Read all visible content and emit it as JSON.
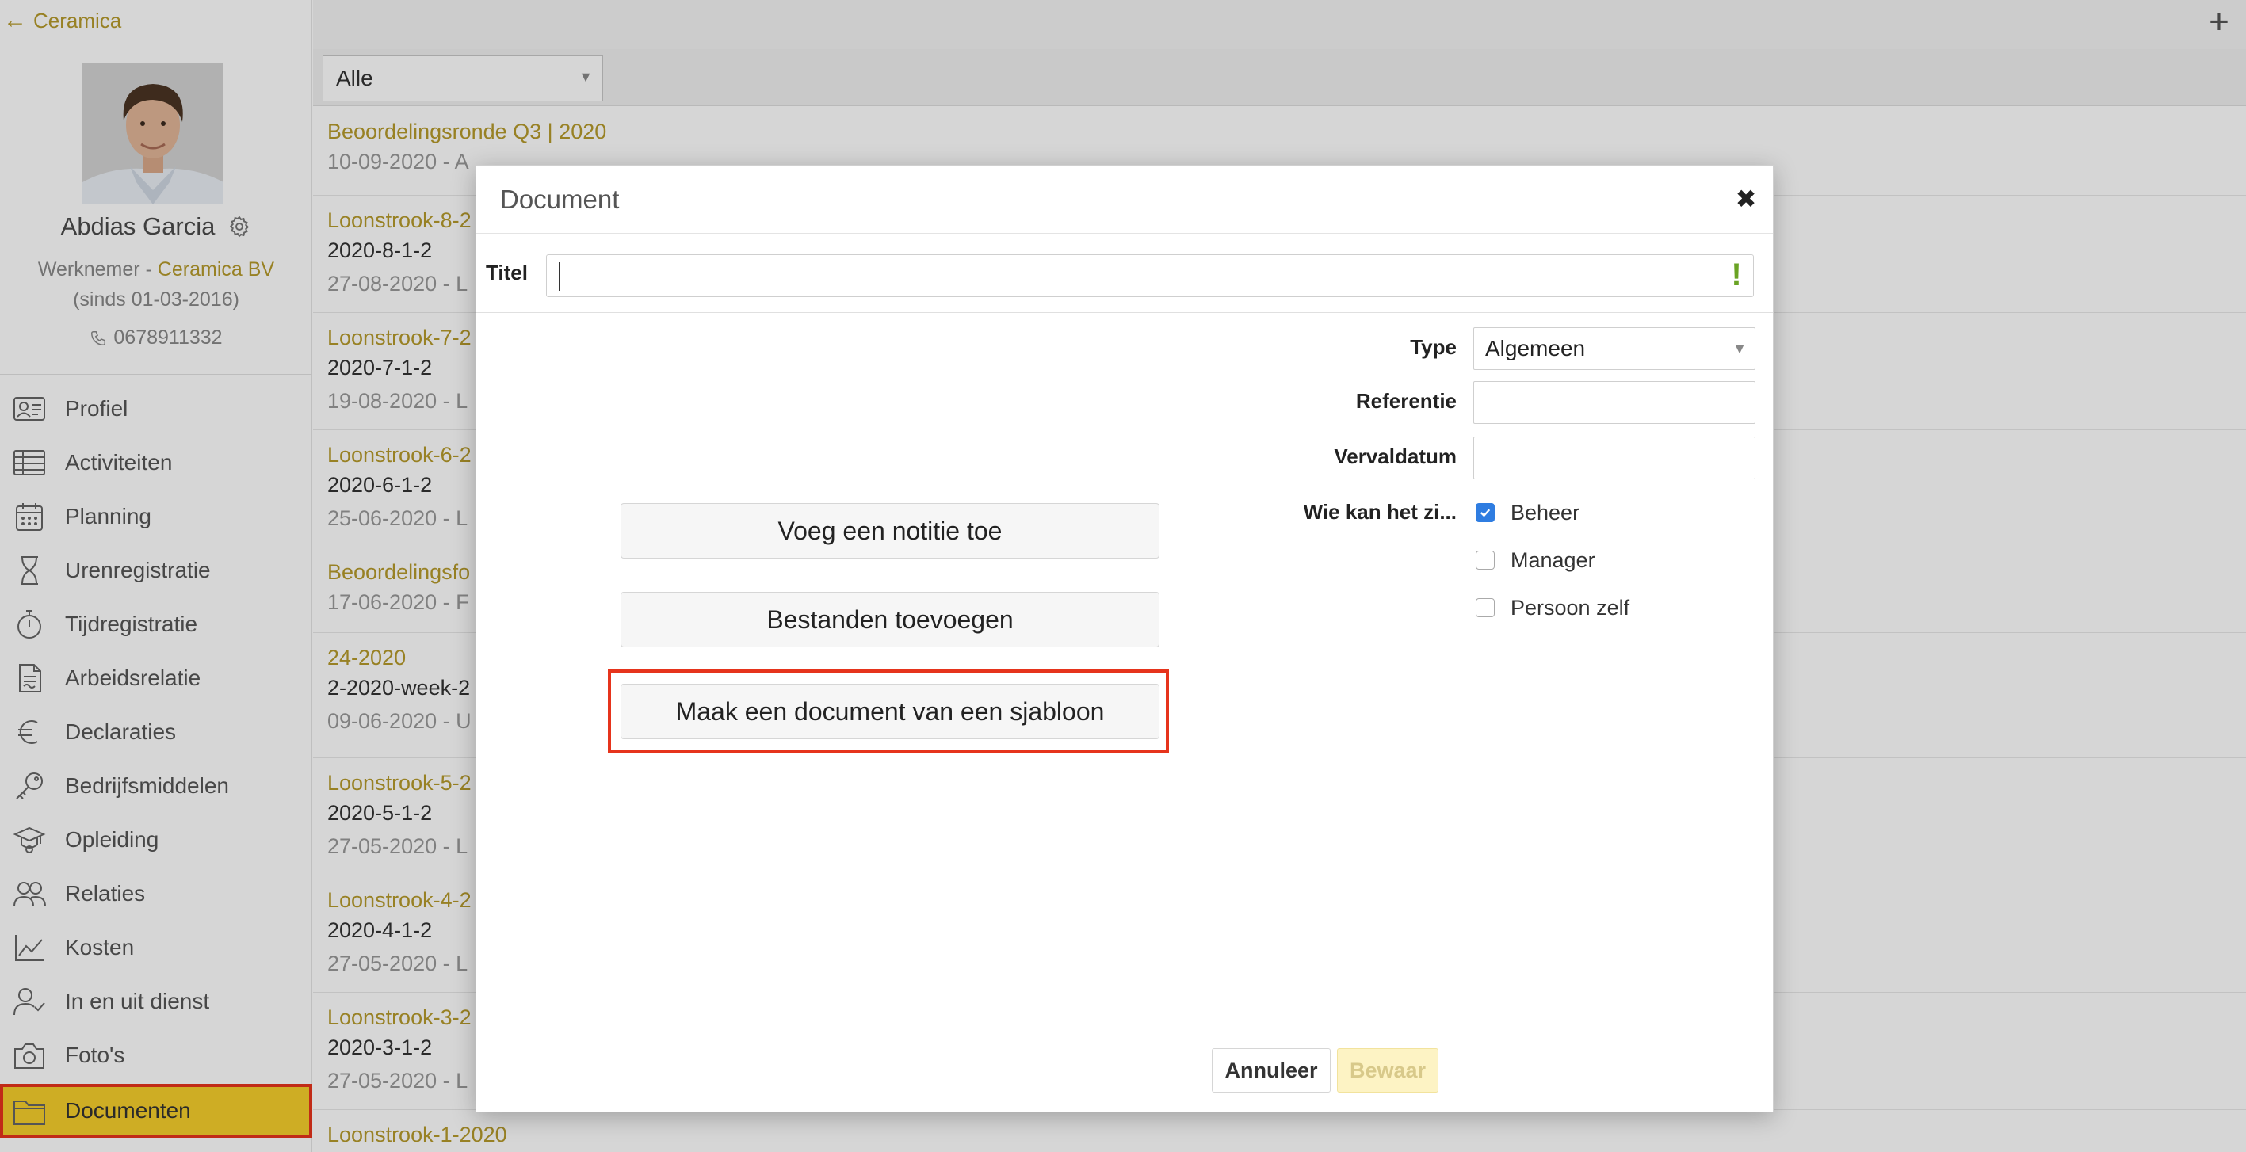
{
  "back_link": {
    "label": "Ceramica"
  },
  "person": {
    "name": "Abdias Garcia",
    "role": "Werknemer",
    "role_separator": " - ",
    "company": "Ceramica BV",
    "since": "(sinds 01-03-2016)",
    "phone": "0678911332"
  },
  "sidebar": {
    "items": [
      {
        "label": "Profiel",
        "icon": "profile-card-icon"
      },
      {
        "label": "Activiteiten",
        "icon": "table-icon"
      },
      {
        "label": "Planning",
        "icon": "calendar-icon"
      },
      {
        "label": "Urenregistratie",
        "icon": "hourglass-icon"
      },
      {
        "label": "Tijdregistratie",
        "icon": "stopwatch-icon"
      },
      {
        "label": "Arbeidsrelatie",
        "icon": "contract-icon"
      },
      {
        "label": "Declaraties",
        "icon": "euro-icon"
      },
      {
        "label": "Bedrijfsmiddelen",
        "icon": "key-icon"
      },
      {
        "label": "Opleiding",
        "icon": "graduation-icon"
      },
      {
        "label": "Relaties",
        "icon": "people-icon"
      },
      {
        "label": "Kosten",
        "icon": "chart-icon"
      },
      {
        "label": "In en uit dienst",
        "icon": "user-check-icon"
      },
      {
        "label": "Foto's",
        "icon": "camera-icon"
      },
      {
        "label": "Documenten",
        "icon": "folder-icon",
        "active": true
      }
    ]
  },
  "filter": {
    "selected": "Alle"
  },
  "documents": [
    {
      "title": "Beoordelingsronde Q3 | 2020",
      "sub": "",
      "meta": "10-09-2020 - A"
    },
    {
      "title": "Loonstrook-8-2",
      "sub": "2020-8-1-2",
      "meta": "27-08-2020 - L"
    },
    {
      "title": "Loonstrook-7-2",
      "sub": "2020-7-1-2",
      "meta": "19-08-2020 - L"
    },
    {
      "title": "Loonstrook-6-2",
      "sub": "2020-6-1-2",
      "meta": "25-06-2020 - L"
    },
    {
      "title": "Beoordelingsfo",
      "sub": "",
      "meta": "17-06-2020 - F"
    },
    {
      "title": "24-2020",
      "sub": "2-2020-week-2",
      "meta": "09-06-2020 - U"
    },
    {
      "title": "Loonstrook-5-2",
      "sub": "2020-5-1-2",
      "meta": "27-05-2020 - L"
    },
    {
      "title": "Loonstrook-4-2",
      "sub": "2020-4-1-2",
      "meta": "27-05-2020 - L"
    },
    {
      "title": "Loonstrook-3-2",
      "sub": "2020-3-1-2",
      "meta": "27-05-2020 - L"
    },
    {
      "title": "Loonstrook-1-2020",
      "sub": "",
      "meta": ""
    }
  ],
  "dialog": {
    "title": "Document",
    "title_field_label": "Titel",
    "title_value": "",
    "required_mark": "!",
    "actions": {
      "add_note": "Voeg een notitie toe",
      "add_files": "Bestanden toevoegen",
      "from_template": "Maak een document van een sjabloon"
    },
    "form": {
      "type_label": "Type",
      "type_value": "Algemeen",
      "reference_label": "Referentie",
      "reference_value": "",
      "expiry_label": "Vervaldatum",
      "expiry_value": "",
      "visibility_label": "Wie kan het zi...",
      "visibility_options": [
        {
          "label": "Beheer",
          "checked": true
        },
        {
          "label": "Manager",
          "checked": false
        },
        {
          "label": "Persoon zelf",
          "checked": false
        }
      ]
    },
    "cancel_label": "Annuleer",
    "save_label": "Bewaar"
  },
  "colors": {
    "accent": "#b59a2b",
    "active_nav": "#f6ce2c",
    "highlight": "#e6341c",
    "checkbox": "#2f7de1"
  }
}
